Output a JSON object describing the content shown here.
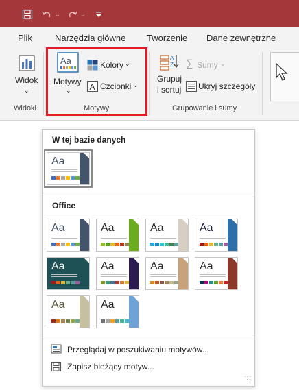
{
  "tabs": [
    "Plik",
    "Narzędzia główne",
    "Tworzenie",
    "Dane zewnętrzne"
  ],
  "ribbon": {
    "widoki": {
      "button_label": "Widok",
      "group_label": "Widoki"
    },
    "motywy": {
      "button_label": "Motywy",
      "colors_label": "Kolory",
      "fonts_label": "Czcionki",
      "group_label": "Motywy"
    },
    "grupowanie": {
      "group_sort_line1": "Grupuj",
      "group_sort_line2": "i sortuj",
      "totals_label": "Sumy",
      "hide_details_label": "Ukryj szczegóły",
      "group_label": "Grupowanie i sumy"
    }
  },
  "gallery": {
    "section_database": "W tej bazie danych",
    "section_office": "Office",
    "thumb_text": "Aa",
    "database_themes": [
      {
        "name": "current",
        "text_color": "#44546a",
        "accent": "#44546a",
        "swatches": [
          "#4472c4",
          "#ed7d31",
          "#a5a5a5",
          "#ffc000",
          "#5b9bd5",
          "#70ad47"
        ],
        "selected": true
      }
    ],
    "office_themes": [
      {
        "name": "office",
        "text_color": "#44546a",
        "accent": "#44546a",
        "swatches": [
          "#4472c4",
          "#ed7d31",
          "#a5a5a5",
          "#ffc000",
          "#5b9bd5",
          "#70ad47"
        ]
      },
      {
        "name": "facet",
        "text_color": "#262626",
        "accent": "#6aac1e",
        "swatches": [
          "#90c226",
          "#54a021",
          "#e6b91e",
          "#e76618",
          "#c42f1a",
          "#918655"
        ]
      },
      {
        "name": "integral",
        "text_color": "#262626",
        "accent": "#d7cfc4",
        "swatches": [
          "#1cade4",
          "#2683c6",
          "#27ced7",
          "#42ba97",
          "#3e8853",
          "#62a39f"
        ]
      },
      {
        "name": "ion-boardroom",
        "text_color": "#1b1d3d",
        "accent": "#2e6fa7",
        "swatches": [
          "#b01513",
          "#ea6312",
          "#e6b729",
          "#6aac90",
          "#5f9c9d",
          "#9e5e9b"
        ]
      },
      {
        "name": "ion",
        "text_color": "#ffffff",
        "accent": "#1e5155",
        "bg": "#1e5155",
        "swatches": [
          "#b01513",
          "#ea6312",
          "#e6b729",
          "#6aac90",
          "#5f9c9d",
          "#9e5e9b"
        ]
      },
      {
        "name": "organic",
        "text_color": "#262626",
        "accent": "#2b1b4f",
        "swatches": [
          "#83992a",
          "#3c9770",
          "#44709d",
          "#a23c33",
          "#d97828",
          "#deb340"
        ]
      },
      {
        "name": "retrospect",
        "text_color": "#262626",
        "accent": "#c7a27a",
        "swatches": [
          "#e48312",
          "#bd582c",
          "#865640",
          "#9b8357",
          "#c2bc80",
          "#94a088"
        ]
      },
      {
        "name": "slice",
        "text_color": "#262626",
        "accent": "#8b3a2a",
        "swatches": [
          "#052f61",
          "#a50e82",
          "#14967c",
          "#6a9e1f",
          "#e87d37",
          "#c62324"
        ]
      },
      {
        "name": "wisp",
        "text_color": "#5e5b3a",
        "accent": "#c6c0a0",
        "swatches": [
          "#a53010",
          "#de7e18",
          "#9f8351",
          "#728653",
          "#92aa4c",
          "#6aac91"
        ]
      },
      {
        "name": "view",
        "text_color": "#262626",
        "accent": "#6fa3d8",
        "swatches": [
          "#6f6f74",
          "#a5a5a5",
          "#fda023",
          "#5f9c9d",
          "#42ba97",
          "#47b5d4"
        ]
      }
    ]
  },
  "menu": {
    "browse_label": "Przeglądaj w poszukiwaniu motywów...",
    "save_label": "Zapisz bieżący motyw..."
  }
}
